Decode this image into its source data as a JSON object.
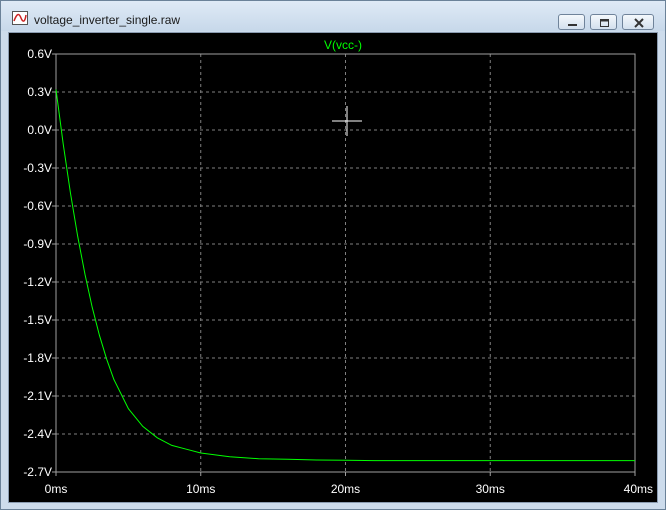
{
  "window": {
    "title": "voltage_inverter_single.raw"
  },
  "icons": {
    "app": "waveform-icon",
    "minimize": "minimize-icon",
    "restore": "restore-icon",
    "close": "close-icon"
  },
  "colors": {
    "plot_background": "#000000",
    "trace": "#00ff00",
    "axis_text": "#ffffff",
    "grid": "#808080",
    "title_bar": "#d8e5f3"
  },
  "chart_data": {
    "type": "line",
    "title": "V(vcc-)",
    "xlabel": "",
    "ylabel": "",
    "xlim": [
      0,
      40
    ],
    "ylim": [
      -2.7,
      0.6
    ],
    "x_ticks": [
      0,
      10,
      20,
      30,
      40
    ],
    "x_tick_labels": [
      "0ms",
      "10ms",
      "20ms",
      "30ms",
      "40ms"
    ],
    "y_ticks": [
      0.6,
      0.3,
      0.0,
      -0.3,
      -0.6,
      -0.9,
      -1.2,
      -1.5,
      -1.8,
      -2.1,
      -2.4,
      -2.7
    ],
    "y_tick_labels": [
      "0.6V",
      "0.3V",
      "0.0V",
      "-0.3V",
      "-0.6V",
      "-0.9V",
      "-1.2V",
      "-1.5V",
      "-1.8V",
      "-2.1V",
      "-2.4V",
      "-2.7V"
    ],
    "grid": true,
    "series": [
      {
        "name": "V(vcc-)",
        "color": "#00ff00",
        "x": [
          0,
          0.5,
          1,
          1.5,
          2,
          2.5,
          3,
          3.5,
          4,
          5,
          6,
          7,
          8,
          9,
          10,
          12,
          14,
          16,
          18,
          20,
          22,
          25,
          30,
          35,
          40
        ],
        "y": [
          0.32,
          -0.11,
          -0.5,
          -0.84,
          -1.14,
          -1.4,
          -1.62,
          -1.81,
          -1.97,
          -2.2,
          -2.34,
          -2.43,
          -2.49,
          -2.52,
          -2.55,
          -2.58,
          -2.595,
          -2.6,
          -2.605,
          -2.607,
          -2.61,
          -2.61,
          -2.61,
          -2.61,
          -2.61
        ]
      }
    ]
  }
}
